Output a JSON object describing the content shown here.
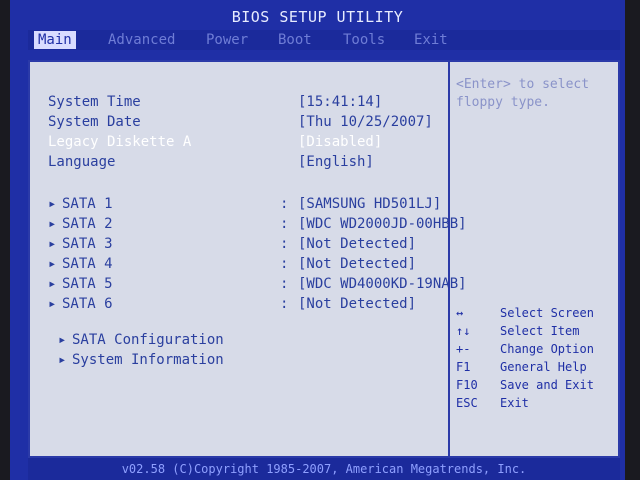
{
  "app": {
    "title": "BIOS SETUP UTILITY"
  },
  "menu": {
    "items": [
      {
        "label": "Main"
      },
      {
        "label": "Advanced"
      },
      {
        "label": "Power"
      },
      {
        "label": "Boot"
      },
      {
        "label": "Tools"
      },
      {
        "label": "Exit"
      }
    ]
  },
  "main": {
    "settings": [
      {
        "label": "System Time",
        "value": "[15:41:14]"
      },
      {
        "label": "System Date",
        "value": "[Thu 10/25/2007]"
      },
      {
        "label": "Legacy Diskette A",
        "value": "[Disabled]"
      },
      {
        "label": "Language",
        "value": "[English]"
      }
    ],
    "devices": [
      {
        "label": "SATA 1",
        "value": "[SAMSUNG HD501LJ]"
      },
      {
        "label": "SATA 2",
        "value": "[WDC WD2000JD-00HBB]"
      },
      {
        "label": "SATA 3",
        "value": "[Not Detected]"
      },
      {
        "label": "SATA 4",
        "value": "[Not Detected]"
      },
      {
        "label": "SATA 5",
        "value": "[WDC WD4000KD-19NAB]"
      },
      {
        "label": "SATA 6",
        "value": "[Not Detected]"
      }
    ],
    "submenus": [
      {
        "label": "SATA Configuration"
      },
      {
        "label": "System Information"
      }
    ]
  },
  "help": {
    "text": "<Enter> to select floppy type."
  },
  "keys": [
    {
      "key": "↔",
      "desc": "Select Screen"
    },
    {
      "key": "↑↓",
      "desc": "Select Item"
    },
    {
      "key": "+-",
      "desc": "Change Option"
    },
    {
      "key": "F1",
      "desc": "General Help"
    },
    {
      "key": "F10",
      "desc": "Save and Exit"
    },
    {
      "key": "ESC",
      "desc": "Exit"
    }
  ],
  "footer": {
    "text": "v02.58 (C)Copyright 1985-2007, American Megatrends, Inc."
  }
}
